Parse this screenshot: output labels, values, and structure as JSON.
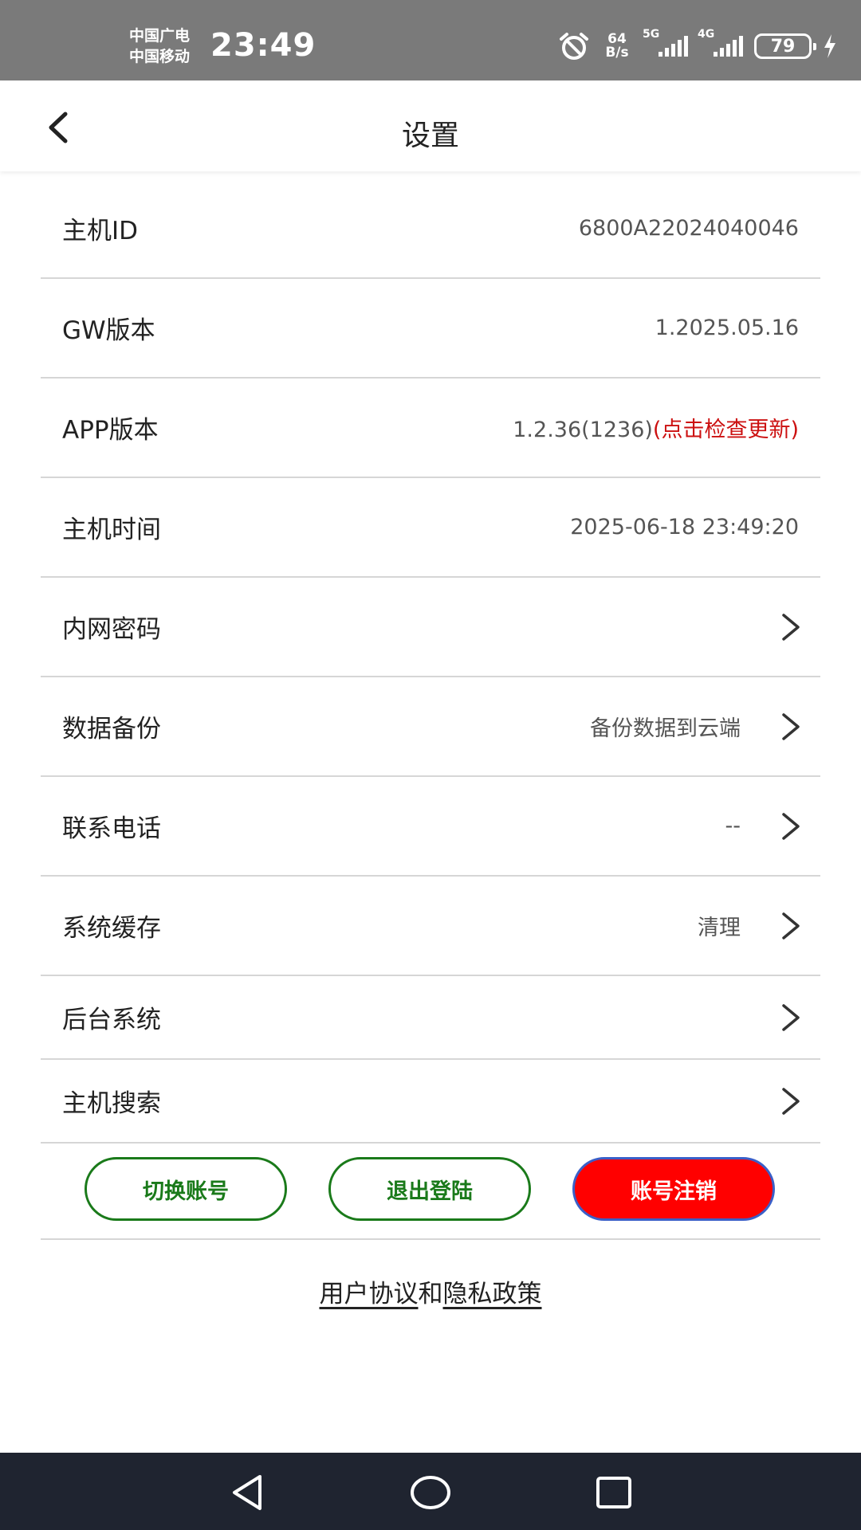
{
  "status_bar": {
    "carrier_1": "中国广电",
    "carrier_2": "中国移动",
    "time": "23:49",
    "net_speed_value": "64",
    "net_speed_unit": "B/s",
    "signal_1_label": "5G",
    "signal_2_label": "4G",
    "battery": "79"
  },
  "header": {
    "title": "设置"
  },
  "rows": [
    {
      "label": "主机ID",
      "value": "6800A22024040046"
    },
    {
      "label": "GW版本",
      "value": "1.2025.05.16"
    },
    {
      "label": "APP版本",
      "value": "1.2.36(1236)",
      "extra": "(点击检查更新)"
    },
    {
      "label": "主机时间",
      "value": "2025-06-18 23:49:20"
    },
    {
      "label": "内网密码",
      "value": ""
    },
    {
      "label": "数据备份",
      "value": "备份数据到云端"
    },
    {
      "label": "联系电话",
      "value": "--"
    },
    {
      "label": "系统缓存",
      "value": "清理"
    },
    {
      "label": "后台系统",
      "value": ""
    },
    {
      "label": "主机搜索",
      "value": ""
    }
  ],
  "buttons": {
    "switch_account": "切换账号",
    "logout": "退出登陆",
    "delete_account": "账号注销"
  },
  "policy": {
    "user_agreement": "用户协议",
    "conjunction": "和",
    "privacy_policy": "隐私政策"
  },
  "colors": {
    "status_bar_bg": "#7a7a7a",
    "accent_green": "#1a7a1a",
    "danger_red": "#ff0000",
    "update_link_red": "#cc1010",
    "nav_bar_bg": "#1f2430"
  }
}
